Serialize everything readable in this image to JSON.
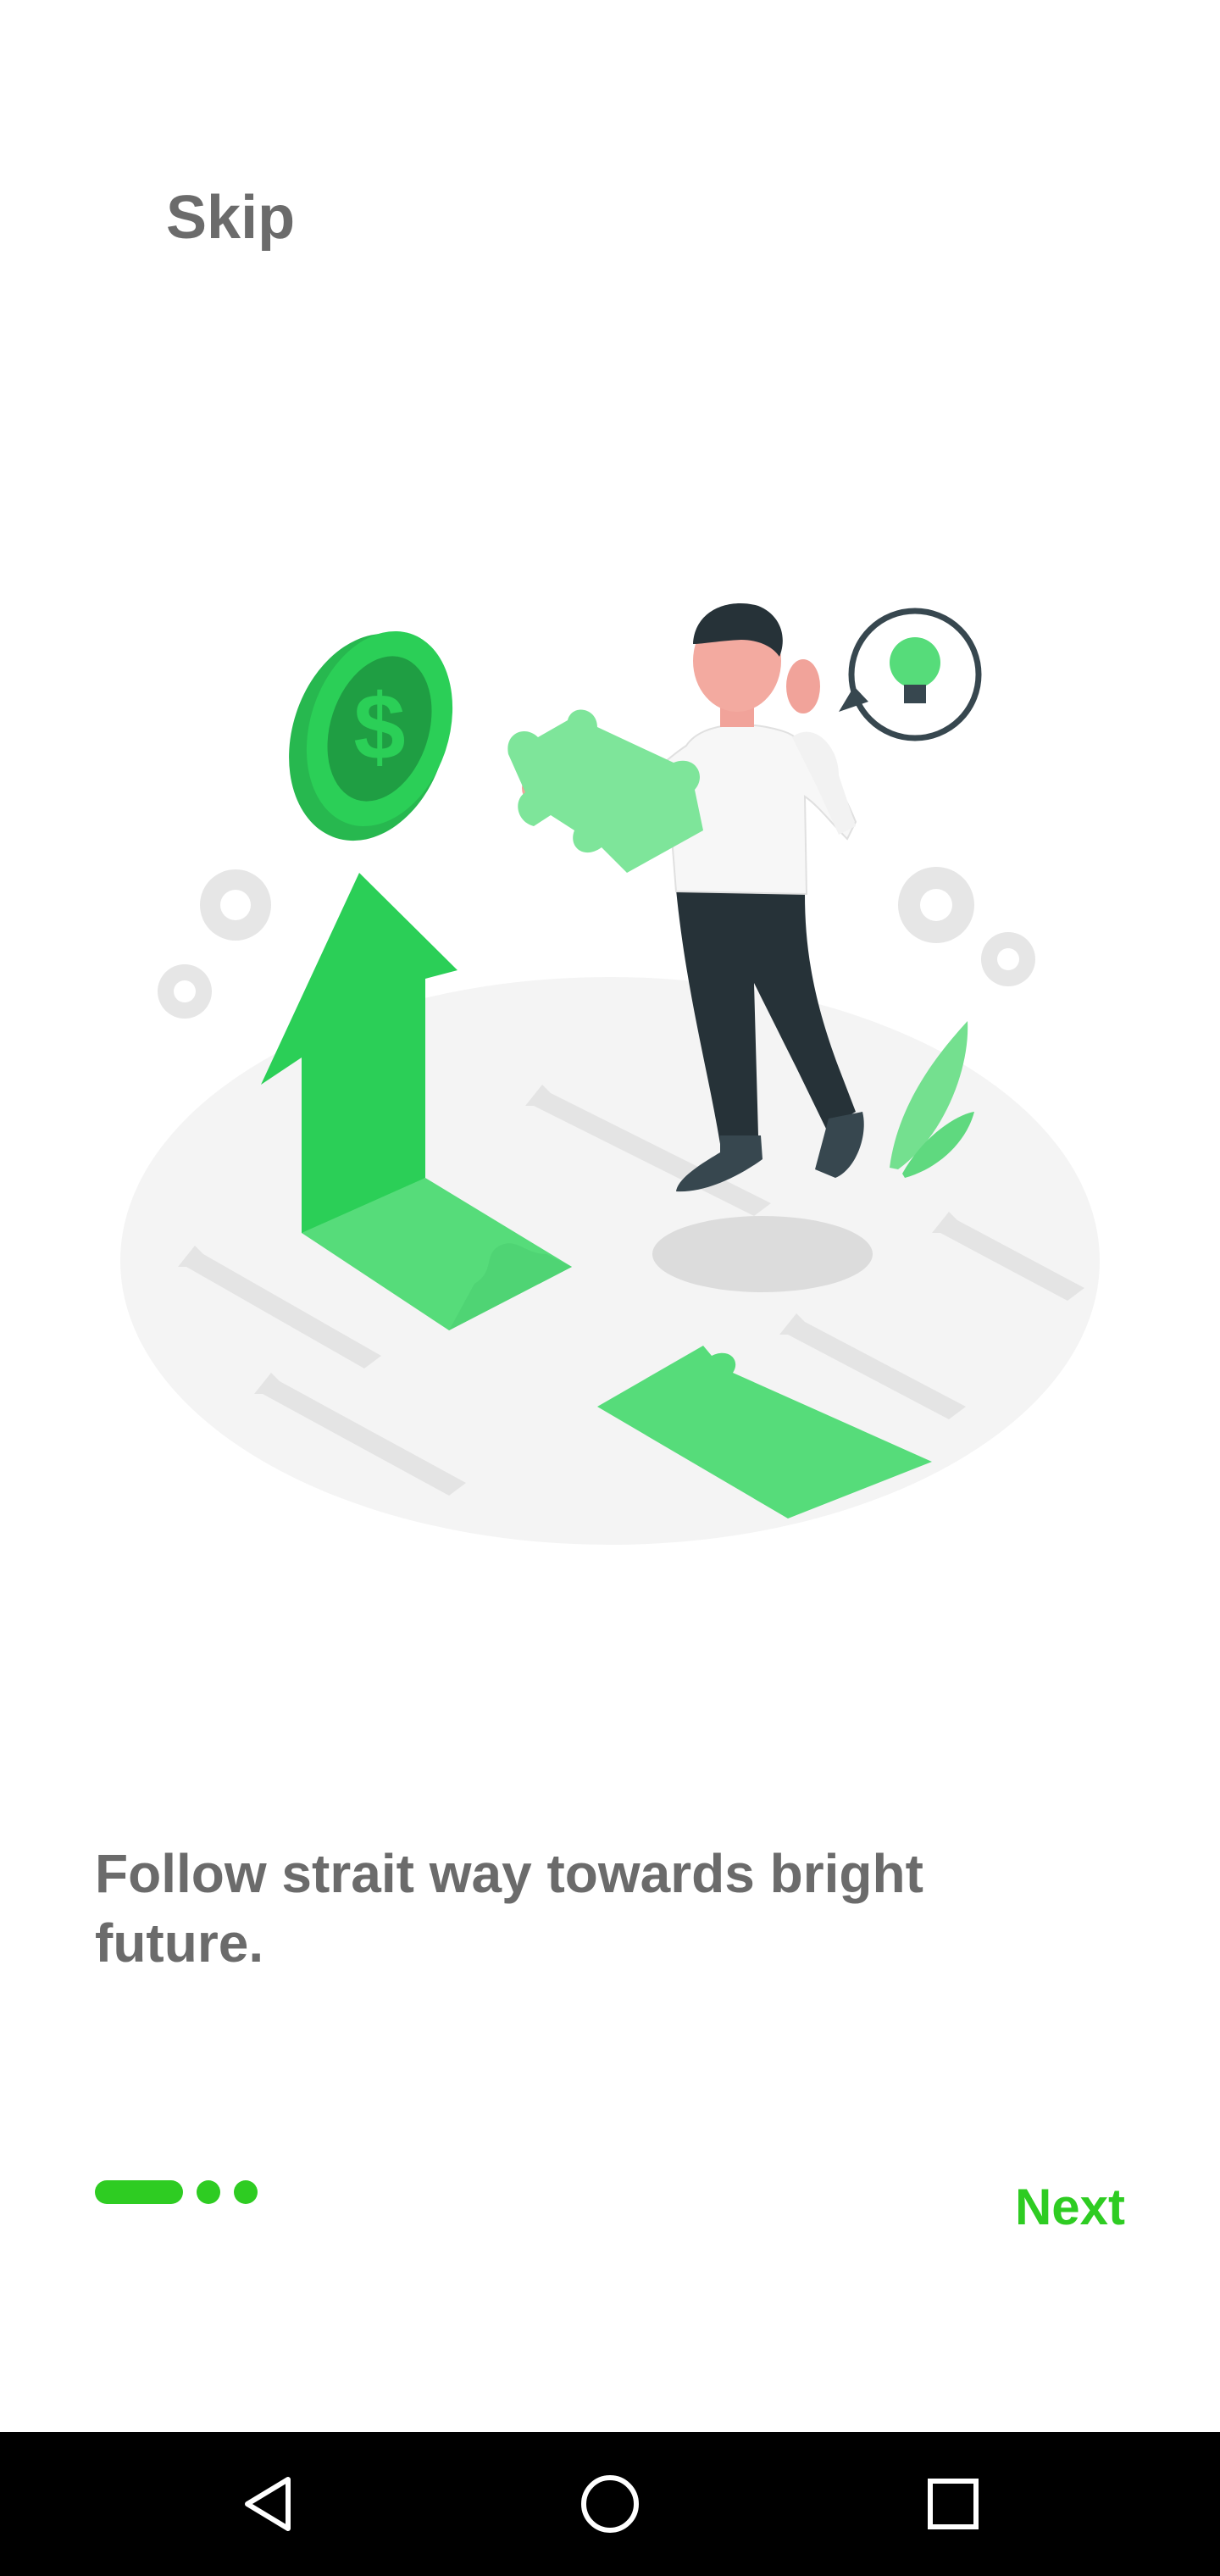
{
  "header": {
    "skip_label": "Skip"
  },
  "onboarding": {
    "illustration_icon": "person-with-puzzle-and-growth-arrow-illustration",
    "caption": "Follow strait way towards bright future.",
    "page_indicator": {
      "current": 1,
      "total": 3
    },
    "next_label": "Next"
  },
  "system_nav": {
    "back_icon": "back-triangle-icon",
    "home_icon": "home-circle-icon",
    "recents_icon": "recents-square-icon"
  },
  "colors": {
    "accent": "#2ecc22",
    "text_gray": "#6b6b6b",
    "illustration_green": "#2bcf57",
    "illustration_light_green": "#56dc7a",
    "navbar": "#000000"
  }
}
